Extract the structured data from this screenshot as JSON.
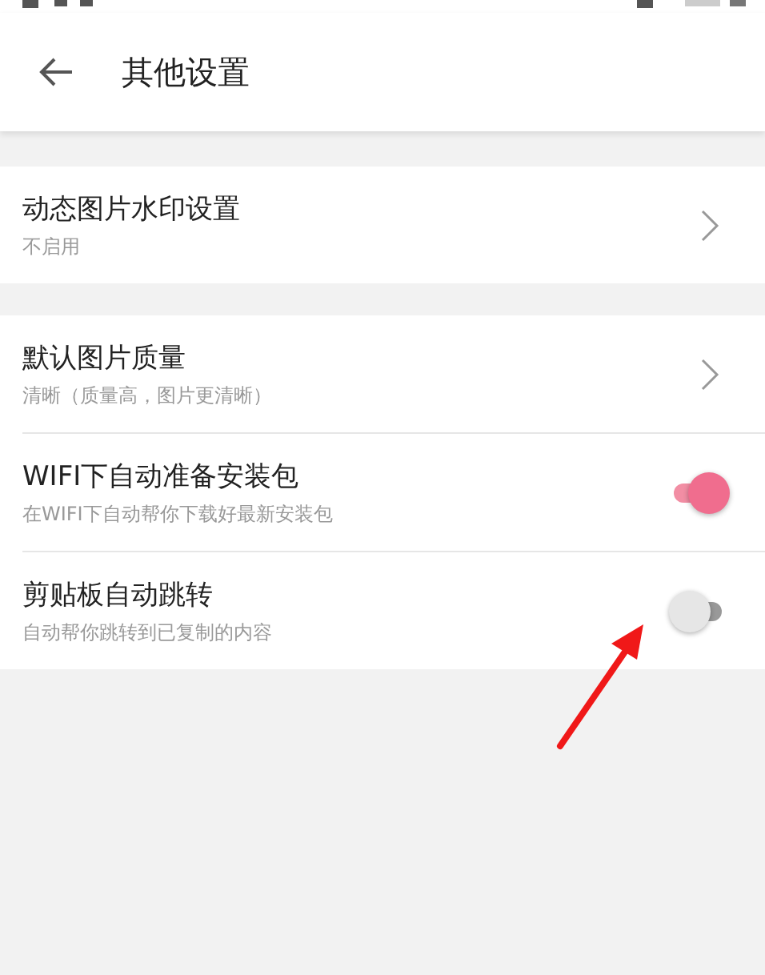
{
  "header": {
    "title": "其他设置"
  },
  "groups": [
    {
      "items": [
        {
          "kind": "link",
          "title": "动态图片水印设置",
          "subtitle": "不启用"
        }
      ]
    },
    {
      "items": [
        {
          "kind": "link",
          "title": "默认图片质量",
          "subtitle": "清晰（质量高，图片更清晰）"
        },
        {
          "kind": "switch",
          "title": "WIFI下自动准备安装包",
          "subtitle": "在WIFI下自动帮你下载好最新安装包",
          "on": true
        },
        {
          "kind": "switch",
          "title": "剪贴板自动跳转",
          "subtitle": "自动帮你跳转到已复制的内容",
          "on": false
        }
      ]
    }
  ]
}
